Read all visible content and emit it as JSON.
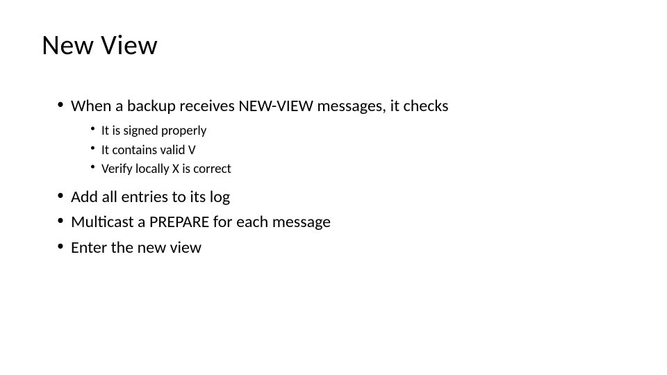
{
  "title": "New View",
  "bullets": {
    "b1": "When a backup receives NEW-VIEW messages, it checks",
    "sub": {
      "s1": "It is signed properly",
      "s2": "It contains valid V",
      "s3": "Verify locally X is correct"
    },
    "b2": "Add all entries to its log",
    "b3": "Multicast a PREPARE for each message",
    "b4": "Enter the new view"
  }
}
